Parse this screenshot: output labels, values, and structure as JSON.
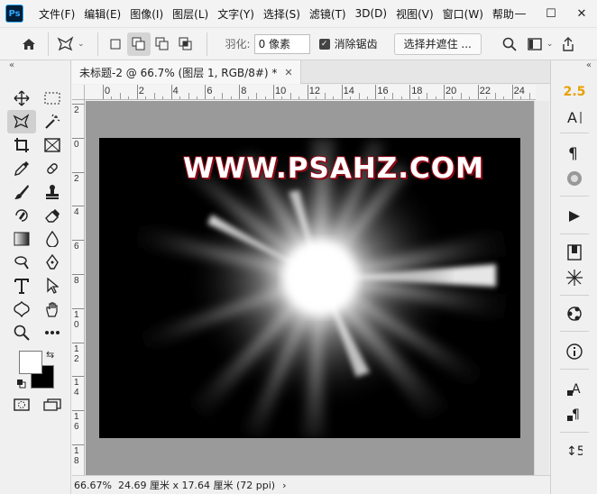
{
  "app": {
    "logo": "Ps"
  },
  "menu": [
    "文件(F)",
    "编辑(E)",
    "图像(I)",
    "图层(L)",
    "文字(Y)",
    "选择(S)",
    "滤镜(T)",
    "3D(D)",
    "视图(V)",
    "窗口(W)",
    "帮助"
  ],
  "options": {
    "feather_label": "羽化:",
    "feather_value": "0 像素",
    "antialias_label": "消除锯齿",
    "select_mask_button": "选择并遮住 ..."
  },
  "document": {
    "tab_title": "未标题-2 @ 66.7% (图层 1, RGB/8#) *",
    "watermark": "WWW.PSAHZ.COM"
  },
  "ruler": {
    "h_labels": [
      "0",
      "2",
      "4",
      "6",
      "8",
      "10",
      "12",
      "14",
      "16",
      "18",
      "20",
      "22",
      "24"
    ],
    "v_labels": [
      "2",
      "0",
      "2",
      "4",
      "6",
      "8",
      "1\n0",
      "1\n2",
      "1\n4",
      "1\n6",
      "1\n8"
    ]
  },
  "status": {
    "zoom": "66.67%",
    "doc_size": "24.69 厘米 x 17.64 厘米 (72 ppi)",
    "arrow": "›"
  },
  "right_dock": {
    "version_badge": "2.5"
  },
  "colors": {
    "accent": "#31a8ff",
    "watermark_outline": "#8b0a17",
    "badge": "#e8a000"
  },
  "icons": [
    "home-icon",
    "lasso-icon",
    "new-selection-icon",
    "add-selection-icon",
    "subtract-selection-icon",
    "intersect-selection-icon",
    "search-icon",
    "workspace-icon",
    "share-icon"
  ]
}
